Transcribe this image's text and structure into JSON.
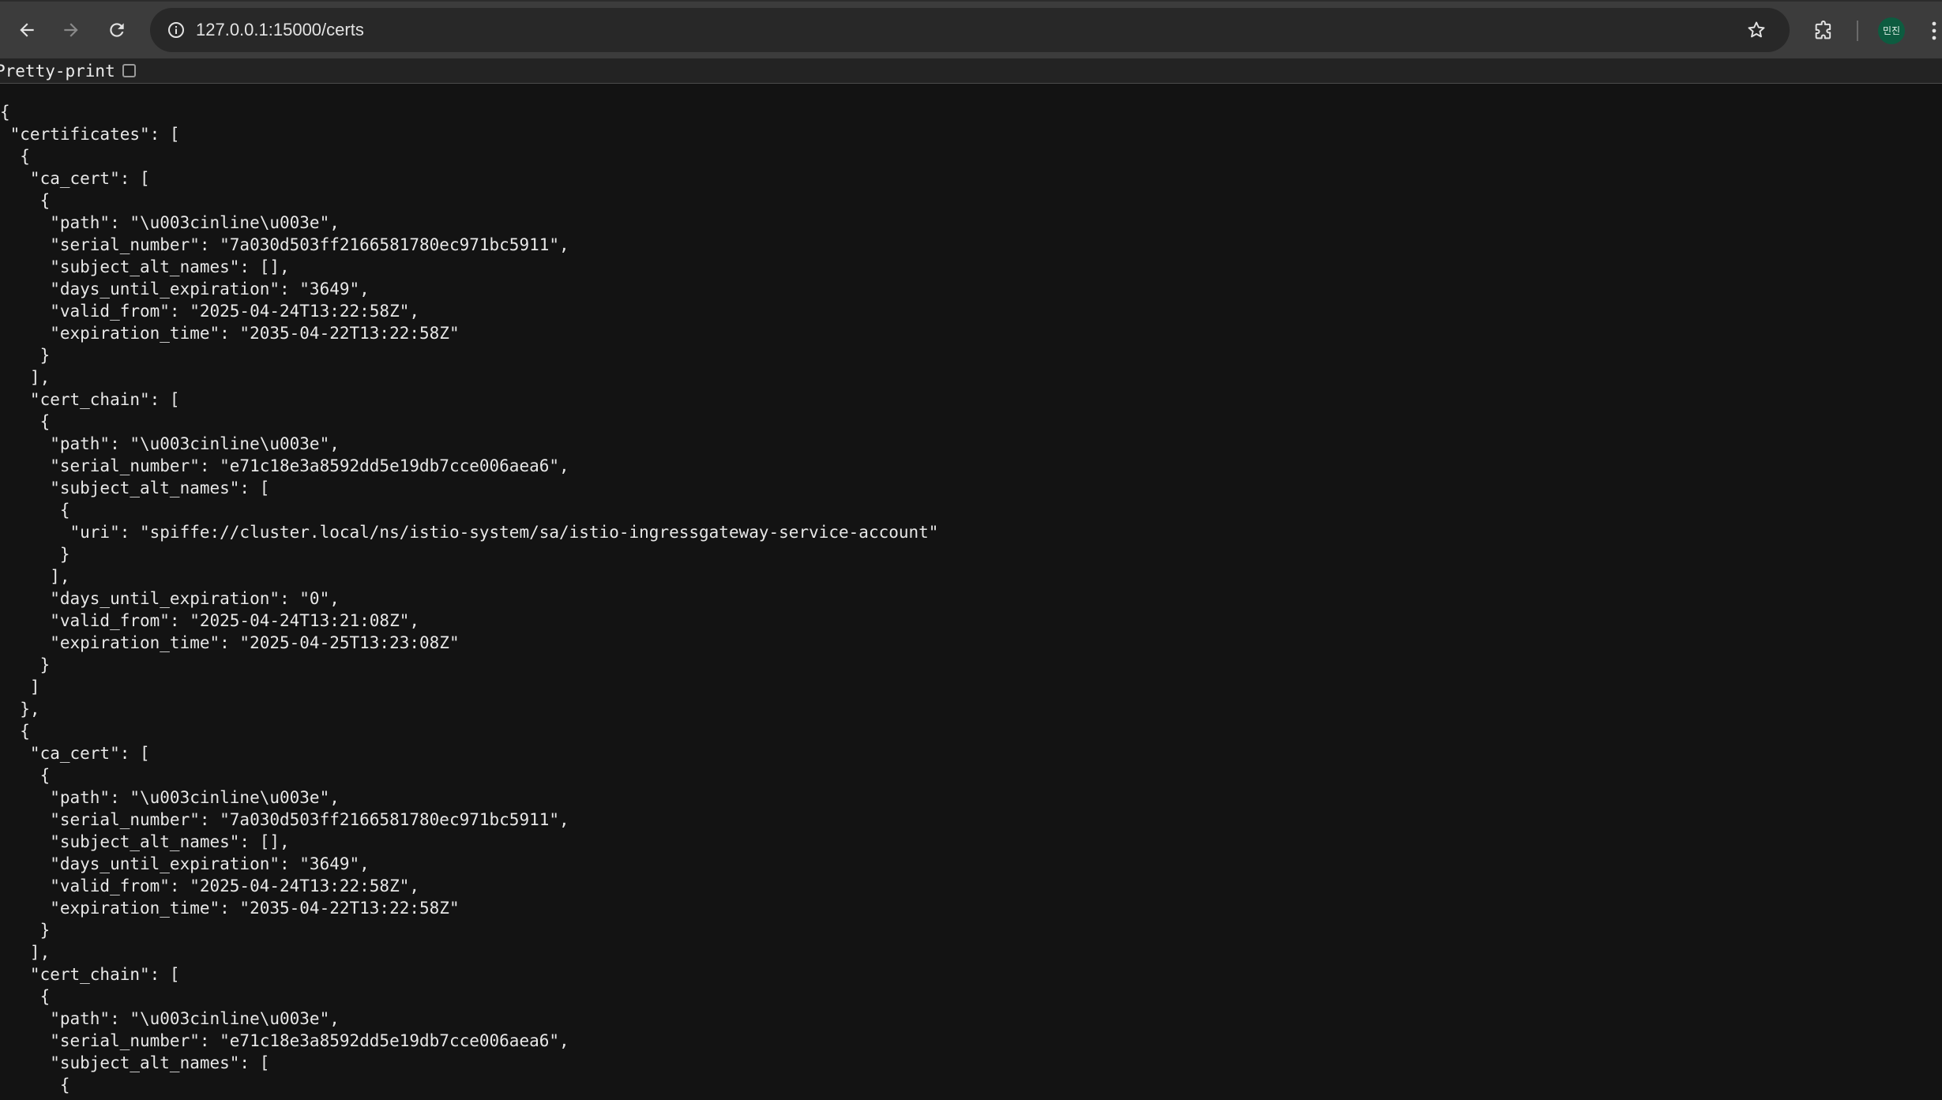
{
  "browser": {
    "url": "127.0.0.1:15000/certs",
    "profile_initials": "민진",
    "colors": {
      "toolbar": "#3c3c3c",
      "omnibox": "#282828",
      "page_background": "#131313",
      "avatar": "#0d5c40"
    }
  },
  "page": {
    "pretty_print_label": "Pretty-print",
    "pretty_print_checked": false,
    "json_lines": [
      "{",
      " \"certificates\": [",
      "  {",
      "   \"ca_cert\": [",
      "    {",
      "     \"path\": \"\\u003cinline\\u003e\",",
      "     \"serial_number\": \"7a030d503ff2166581780ec971bc5911\",",
      "     \"subject_alt_names\": [],",
      "     \"days_until_expiration\": \"3649\",",
      "     \"valid_from\": \"2025-04-24T13:22:58Z\",",
      "     \"expiration_time\": \"2035-04-22T13:22:58Z\"",
      "    }",
      "   ],",
      "   \"cert_chain\": [",
      "    {",
      "     \"path\": \"\\u003cinline\\u003e\",",
      "     \"serial_number\": \"e71c18e3a8592dd5e19db7cce006aea6\",",
      "     \"subject_alt_names\": [",
      "      {",
      "       \"uri\": \"spiffe://cluster.local/ns/istio-system/sa/istio-ingressgateway-service-account\"",
      "      }",
      "     ],",
      "     \"days_until_expiration\": \"0\",",
      "     \"valid_from\": \"2025-04-24T13:21:08Z\",",
      "     \"expiration_time\": \"2025-04-25T13:23:08Z\"",
      "    }",
      "   ]",
      "  },",
      "  {",
      "   \"ca_cert\": [",
      "    {",
      "     \"path\": \"\\u003cinline\\u003e\",",
      "     \"serial_number\": \"7a030d503ff2166581780ec971bc5911\",",
      "     \"subject_alt_names\": [],",
      "     \"days_until_expiration\": \"3649\",",
      "     \"valid_from\": \"2025-04-24T13:22:58Z\",",
      "     \"expiration_time\": \"2035-04-22T13:22:58Z\"",
      "    }",
      "   ],",
      "   \"cert_chain\": [",
      "    {",
      "     \"path\": \"\\u003cinline\\u003e\",",
      "     \"serial_number\": \"e71c18e3a8592dd5e19db7cce006aea6\",",
      "     \"subject_alt_names\": [",
      "      {"
    ]
  }
}
